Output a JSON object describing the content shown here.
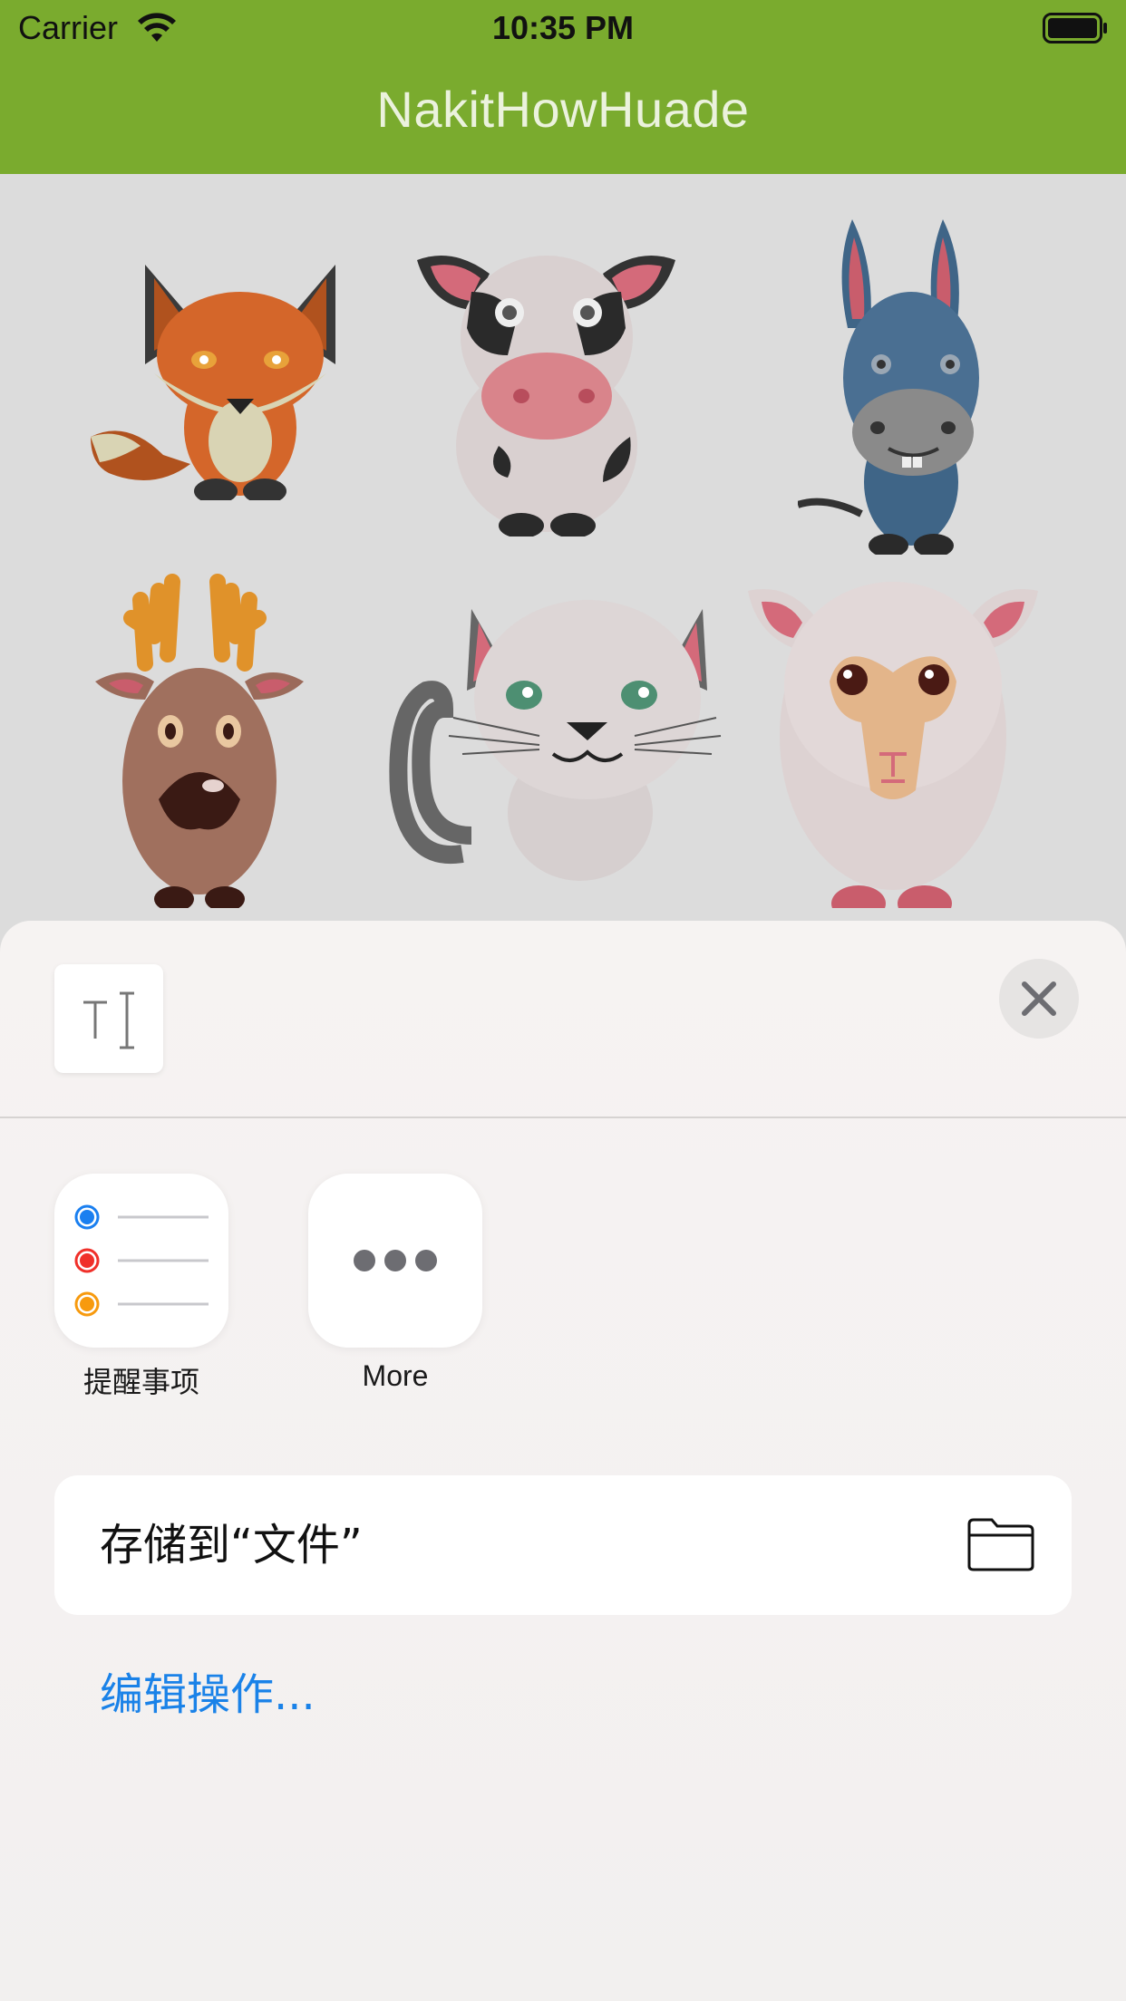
{
  "status_bar": {
    "carrier": "Carrier",
    "time": "10:35 PM"
  },
  "nav": {
    "title": "NakitHowHuade"
  },
  "animals": [
    "fox",
    "cow",
    "donkey",
    "deer",
    "cat",
    "sheep"
  ],
  "share_sheet": {
    "apps": [
      {
        "label": "提醒事项",
        "icon": "reminders-icon"
      },
      {
        "label": "More",
        "icon": "more-icon"
      }
    ],
    "actions": [
      {
        "label": "存储到“文件”",
        "icon": "folder-icon"
      }
    ],
    "edit_actions_label": "编辑操作..."
  },
  "colors": {
    "nav_bar": "#7aab2e",
    "link": "#1a82e8"
  }
}
